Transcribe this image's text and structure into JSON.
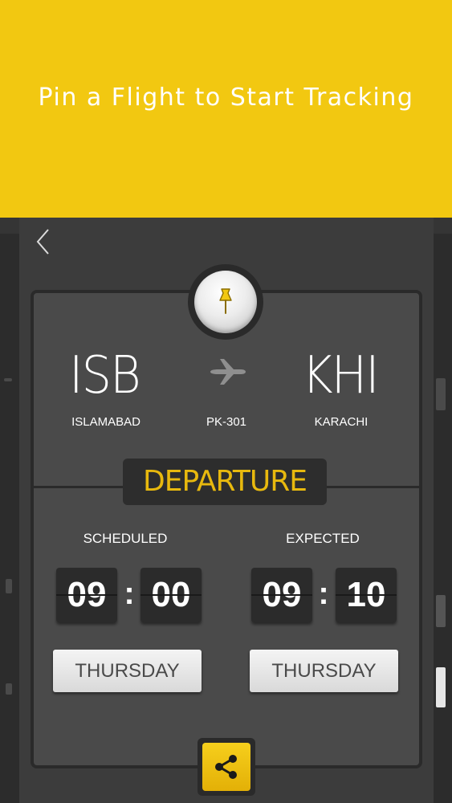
{
  "banner": {
    "title": "Pin a Flight to Start Tracking"
  },
  "colors": {
    "banner": "#f2c811",
    "accent": "#e8b90e",
    "dark": "#353535"
  },
  "nav": {
    "back_icon": "chevron-left-icon"
  },
  "pin": {
    "icon": "pushpin-icon"
  },
  "flight": {
    "origin_code": "ISB",
    "origin_city": "ISLAMABAD",
    "destination_code": "KHI",
    "destination_city": "KARACHI",
    "flight_number": "PK-301",
    "plane_icon": "airplane-icon"
  },
  "status": {
    "label": "DEPARTURE"
  },
  "scheduled": {
    "label": "SCHEDULED",
    "hours": "09",
    "minutes": "00",
    "day": "THURSDAY"
  },
  "expected": {
    "label": "EXPECTED",
    "hours": "09",
    "minutes": "10",
    "day": "THURSDAY"
  },
  "share": {
    "icon": "share-icon"
  }
}
